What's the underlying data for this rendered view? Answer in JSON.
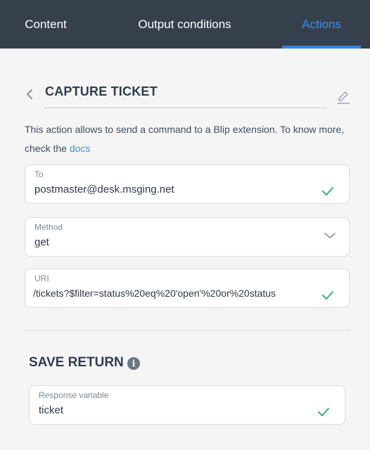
{
  "tabs": [
    {
      "label": "Content"
    },
    {
      "label": "Output conditions"
    },
    {
      "label": "Actions"
    }
  ],
  "active_tab": "Actions",
  "action": {
    "title": "CAPTURE TICKET",
    "description_text": "This action allows to send a command to a Blip extension. To know more, check the ",
    "description_link": "docs"
  },
  "fields": {
    "to": {
      "label": "To",
      "value": "postmaster@desk.msging.net"
    },
    "method": {
      "label": "Method",
      "value": "get"
    },
    "uri": {
      "label": "URI",
      "value": "/tickets?$filter=status%20eq%20'open'%20or%20status"
    }
  },
  "save_return": {
    "title": "SAVE RETURN",
    "info_glyph": "i",
    "response": {
      "label": "Response variable",
      "value": "ticket"
    }
  },
  "colors": {
    "header_bg": "#363f4c",
    "accent": "#2f86e6",
    "valid_check": "#37b26c"
  },
  "icons": [
    "chevron-left-icon",
    "pencil-icon",
    "check-icon",
    "chevron-down-icon",
    "info-icon"
  ]
}
